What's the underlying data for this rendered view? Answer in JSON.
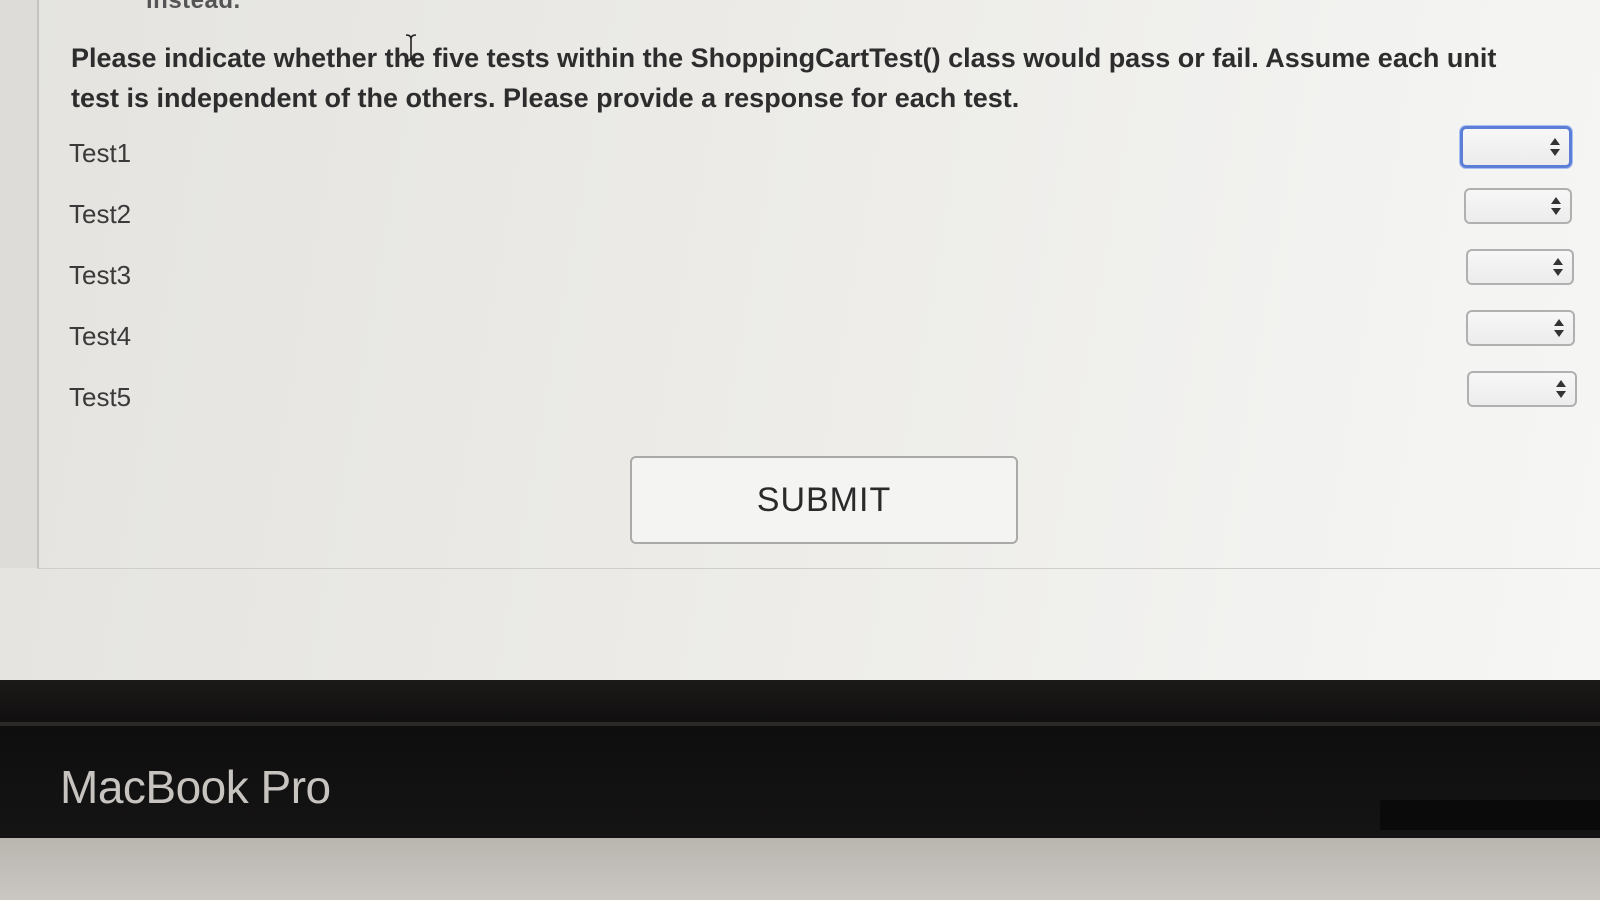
{
  "cut_off_text": "instead.",
  "question": {
    "text": "Please indicate whether the five tests within the ShoppingCartTest() class would pass or fail. Assume each unit test is independent of the others. Please provide a response for each test."
  },
  "tests": [
    {
      "label": "Test1",
      "value": ""
    },
    {
      "label": "Test2",
      "value": ""
    },
    {
      "label": "Test3",
      "value": ""
    },
    {
      "label": "Test4",
      "value": ""
    },
    {
      "label": "Test5",
      "value": ""
    }
  ],
  "submit_label": "SUBMIT",
  "laptop_brand": "MacBook Pro",
  "icons": {
    "cursor": "text-cursor-icon",
    "select_arrows": "updown-arrows-icon"
  },
  "colors": {
    "focus_ring": "#5b7fd8",
    "text": "#2d2d2d"
  }
}
